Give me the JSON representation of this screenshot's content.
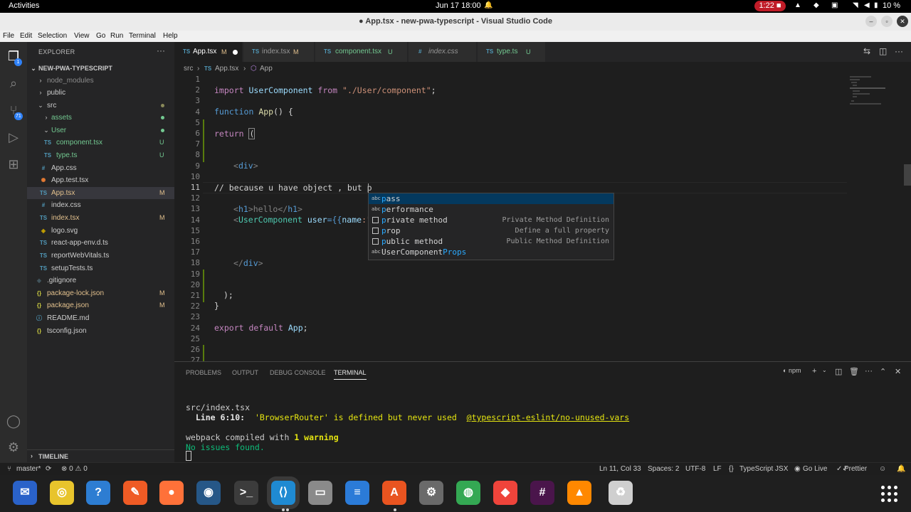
{
  "topbar": {
    "activities": "Activities",
    "clock": "Jun 17  18:00",
    "recording": "1:22",
    "battery": "10 %"
  },
  "window": {
    "title": "● App.tsx - new-pwa-typescript - Visual Studio Code",
    "minimize": "–",
    "maximize": "▫",
    "close": "✕"
  },
  "menu": [
    "File",
    "Edit",
    "Selection",
    "View",
    "Go",
    "Run",
    "Terminal",
    "Help"
  ],
  "activity_bar": {
    "scm_badge": "71",
    "explorer_badge": "1"
  },
  "explorer": {
    "header": "EXPLORER",
    "more": "···",
    "root": "NEW-PWA-TYPESCRIPT",
    "items": [
      {
        "name": "node_modules",
        "type": "folder",
        "status": "",
        "color": "#8b8b8b"
      },
      {
        "name": "public",
        "type": "folder",
        "status": "",
        "color": "#cccccc"
      },
      {
        "name": "src",
        "type": "folder-open",
        "status": "dot-olive",
        "color": "#cccccc"
      },
      {
        "name": "assets",
        "type": "folder",
        "status": "dot-green",
        "color": "#73c991"
      },
      {
        "name": "User",
        "type": "folder-open",
        "status": "dot-green",
        "color": "#73c991"
      },
      {
        "name": "component.tsx",
        "type": "ts",
        "status": "U",
        "color": "#73c991"
      },
      {
        "name": "type.ts",
        "type": "ts",
        "status": "U",
        "color": "#73c991"
      },
      {
        "name": "App.css",
        "type": "css",
        "status": "",
        "color": "#cccccc"
      },
      {
        "name": "App.test.tsx",
        "type": "test",
        "status": "",
        "color": "#cccccc"
      },
      {
        "name": "App.tsx",
        "type": "ts",
        "status": "M",
        "color": "#e2c08d"
      },
      {
        "name": "index.css",
        "type": "css",
        "status": "",
        "color": "#cccccc"
      },
      {
        "name": "index.tsx",
        "type": "ts",
        "status": "M",
        "color": "#e2c08d"
      },
      {
        "name": "logo.svg",
        "type": "svg",
        "status": "",
        "color": "#cccccc"
      },
      {
        "name": "react-app-env.d.ts",
        "type": "ts",
        "status": "",
        "color": "#cccccc"
      },
      {
        "name": "reportWebVitals.ts",
        "type": "ts",
        "status": "",
        "color": "#cccccc"
      },
      {
        "name": "setupTests.ts",
        "type": "ts",
        "status": "",
        "color": "#cccccc"
      },
      {
        "name": ".gitignore",
        "type": "git",
        "status": "",
        "color": "#cccccc"
      },
      {
        "name": "package-lock.json",
        "type": "json",
        "status": "M",
        "color": "#e2c08d"
      },
      {
        "name": "package.json",
        "type": "json",
        "status": "M",
        "color": "#e2c08d"
      },
      {
        "name": "README.md",
        "type": "md",
        "status": "",
        "color": "#cccccc"
      },
      {
        "name": "tsconfig.json",
        "type": "json",
        "status": "",
        "color": "#cccccc"
      }
    ],
    "timeline": "TIMELINE"
  },
  "tabs": [
    {
      "prefix": "TS",
      "name": "App.tsx",
      "status": "M",
      "active": true
    },
    {
      "prefix": "TS",
      "name": "index.tsx",
      "status": "M",
      "active": false
    },
    {
      "prefix": "TS",
      "name": "component.tsx",
      "status": "U",
      "active": false
    },
    {
      "prefix": "#",
      "name": "index.css",
      "status": "",
      "active": false
    },
    {
      "prefix": "TS",
      "name": "type.ts",
      "status": "U",
      "active": false
    }
  ],
  "breadcrumb": {
    "folder": "src",
    "sep": "›",
    "ts": "TS",
    "file": "App.tsx",
    "symbol": "App"
  },
  "editor": {
    "line_numbers": [
      "1",
      "2",
      "3",
      "4",
      "5",
      "6",
      "7",
      "8",
      "9",
      "10",
      "11",
      "12",
      "13",
      "14",
      "15",
      "16",
      "17",
      "18",
      "19",
      "20",
      "21",
      "22",
      "23",
      "24",
      "25",
      "26",
      "27"
    ],
    "code": {
      "l2_import": "import ",
      "l2_comp": "UserComponent",
      "l2_from": " from ",
      "l2_path": "\"./User/component\"",
      "l2_end": ";",
      "l4_function": "function ",
      "l4_app": "App",
      "l4_rest": "() {",
      "l6_return": "return ",
      "l6_paren": "(",
      "l9_open": "<",
      "l9_div": "div",
      "l9_close": ">",
      "l11_comment": "// because u have object , but p",
      "l13_a": "<",
      "l13_h1": "h1",
      "l13_b": ">hello</",
      "l13_h1b": "h1",
      "l13_c": ">",
      "l14_a": "<",
      "l14_comp": "UserComponent",
      "l14_attr": " user",
      "l14_eq": "={{",
      "l14_name": "name",
      "l14_str": ":\"",
      "l18_a": "</",
      "l18_div": "div",
      "l18_b": ">",
      "l21": ");",
      "l22": "}",
      "l24_export": "export default ",
      "l24_app": "App",
      "l24_end": ";"
    }
  },
  "suggest": [
    {
      "icon": "abc",
      "pre": "p",
      "rest": "ass",
      "detail": "",
      "selected": true
    },
    {
      "icon": "abc",
      "pre": "p",
      "rest": "erformance",
      "detail": "",
      "selected": false
    },
    {
      "icon": "box",
      "pre": "p",
      "rest": "rivate method",
      "detail": "Private Method Definition",
      "selected": false
    },
    {
      "icon": "box",
      "pre": "p",
      "rest": "rop",
      "detail": "Define a full property",
      "selected": false
    },
    {
      "icon": "box",
      "pre": "p",
      "rest": "ublic method",
      "detail": "Public Method Definition",
      "selected": false
    },
    {
      "icon": "abc",
      "pre": "UserComponent",
      "rest": "Props",
      "detail": "",
      "selected": false
    }
  ],
  "panel": {
    "tabs": [
      "PROBLEMS",
      "OUTPUT",
      "DEBUG CONSOLE",
      "TERMINAL"
    ],
    "npm": "npm",
    "terminal": {
      "file": "src/index.tsx",
      "line_label": "  Line 6:10:",
      "line_msg": "  'BrowserRouter' is defined but never used  ",
      "rule": "@typescript-eslint/no-unused-vars",
      "compiled_pre": "webpack compiled with ",
      "compiled_warn": "1 warning",
      "no_issues": "No issues found."
    }
  },
  "statusbar": {
    "branch": "master*",
    "sync": "⟳",
    "problems": "⊗ 0 ⚠ 0",
    "position": "Ln 11, Col 33",
    "spaces": "Spaces: 2",
    "encoding": "UTF-8",
    "eol": "LF",
    "language": "TypeScript JSX",
    "golive": "Go Live",
    "prettier": "Prettier"
  },
  "dock": [
    {
      "name": "thunderbird",
      "glyph": "✉",
      "bg": "#2a62c9"
    },
    {
      "name": "rhythmbox",
      "glyph": "◎",
      "bg": "#e8c42c"
    },
    {
      "name": "help",
      "glyph": "?",
      "bg": "#2d7dd2"
    },
    {
      "name": "postman",
      "glyph": "✎",
      "bg": "#ef5b25"
    },
    {
      "name": "firefox",
      "glyph": "●",
      "bg": "#ff7139"
    },
    {
      "name": "blender",
      "glyph": "◉",
      "bg": "#265787"
    },
    {
      "name": "terminal",
      "glyph": ">_",
      "bg": "#3c3c3c"
    },
    {
      "name": "vscode",
      "glyph": "⟨⟩",
      "bg": "#1f8ad2"
    },
    {
      "name": "files",
      "glyph": "▭",
      "bg": "#8a8a8a"
    },
    {
      "name": "writer",
      "glyph": "≡",
      "bg": "#2b7bd8"
    },
    {
      "name": "software",
      "glyph": "A",
      "bg": "#e95420"
    },
    {
      "name": "settings",
      "glyph": "⚙",
      "bg": "#6a6a6a"
    },
    {
      "name": "chrome",
      "glyph": "◍",
      "bg": "#34a853"
    },
    {
      "name": "anydesk",
      "glyph": "◆",
      "bg": "#ef443b"
    },
    {
      "name": "slack",
      "glyph": "#",
      "bg": "#4a154b"
    },
    {
      "name": "vlc",
      "glyph": "▲",
      "bg": "#ff8800"
    },
    {
      "name": "trash",
      "glyph": "♻",
      "bg": "#cfcfcf"
    }
  ]
}
